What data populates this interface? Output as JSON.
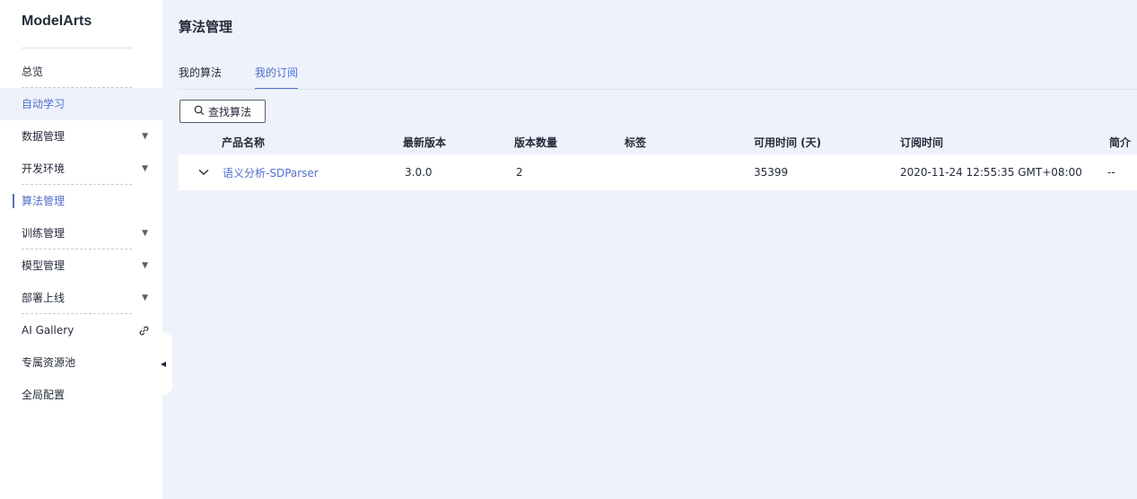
{
  "app": {
    "name": "ModelArts"
  },
  "sidebar": {
    "items": [
      {
        "label": "总览"
      },
      {
        "label": "自动学习"
      },
      {
        "label": "数据管理",
        "caret": "▼"
      },
      {
        "label": "开发环境",
        "caret": "▼"
      },
      {
        "label": "算法管理"
      },
      {
        "label": "训练管理",
        "caret": "▼"
      },
      {
        "label": "模型管理",
        "caret": "▼"
      },
      {
        "label": "部署上线",
        "caret": "▼"
      },
      {
        "label": "AI Gallery",
        "icon": "external-link-icon"
      },
      {
        "label": "专属资源池"
      },
      {
        "label": "全局配置"
      }
    ],
    "collapse_glyph": "◀"
  },
  "main": {
    "title": "算法管理",
    "tabs": [
      {
        "label": "我的算法",
        "active": false
      },
      {
        "label": "我的订阅",
        "active": true
      }
    ],
    "search_button": {
      "label": "查找算法",
      "icon": "search-icon"
    },
    "table": {
      "columns": [
        "产品名称",
        "最新版本",
        "版本数量",
        "标签",
        "可用时间 (天)",
        "订阅时间",
        "简介"
      ],
      "rows": [
        {
          "name": "语义分析-SDParser",
          "latest_version": "3.0.0",
          "version_count": "2",
          "tags": "",
          "available_days": "35399",
          "subscribed_at": "2020-11-24 12:55:35 GMT+08:00",
          "description": "--"
        }
      ]
    }
  },
  "colors": {
    "accent": "#526ecc",
    "background": "#eef2fb",
    "sidebar": "#ffffff",
    "text": "#252b3a"
  }
}
